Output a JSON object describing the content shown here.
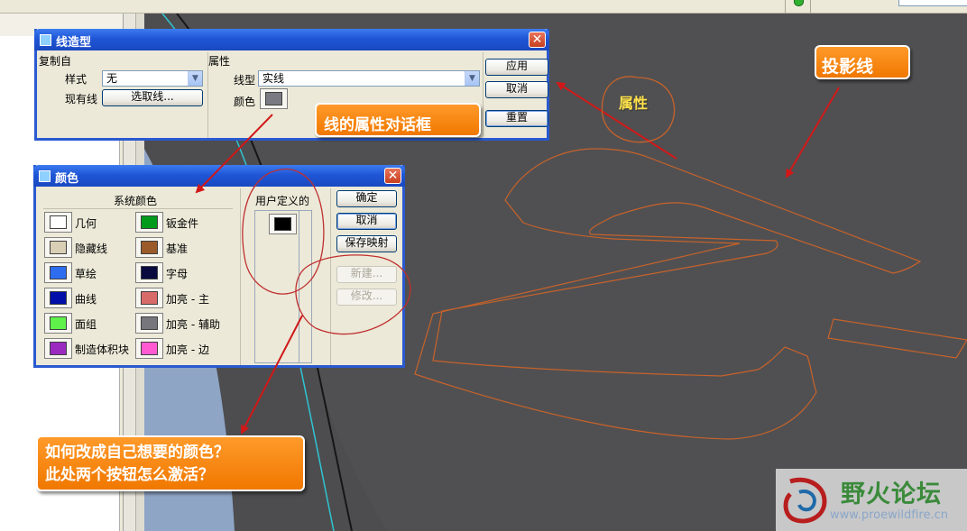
{
  "linestyle_dialog": {
    "title": "线造型",
    "copy_from_group": "复制自",
    "style_label": "样式",
    "style_value": "无",
    "existing_line_label": "现有线",
    "select_line_button": "选取线...",
    "properties_group": "属性",
    "linetype_label": "线型",
    "linetype_value": "实线",
    "color_label": "颜色",
    "color_value": "#7a7a82",
    "apply_button": "应用",
    "cancel_button": "取消",
    "reset_button": "重置"
  },
  "color_dialog": {
    "title": "颜色",
    "system_colors_header": "系统颜色",
    "user_defined_header": "用户定义的",
    "system_colors": [
      {
        "name": "几何",
        "color": "#ffffff"
      },
      {
        "name": "钣金件",
        "color": "#009a1c"
      },
      {
        "name": "隐藏线",
        "color": "#d9cfb4"
      },
      {
        "name": "基准",
        "color": "#9b5a2a"
      },
      {
        "name": "草绘",
        "color": "#2e6cf0"
      },
      {
        "name": "字母",
        "color": "#0a0a40"
      },
      {
        "name": "曲线",
        "color": "#0010a8"
      },
      {
        "name": "加亮 - 主",
        "color": "#d96a6a"
      },
      {
        "name": "面组",
        "color": "#5ef24a"
      },
      {
        "name": "加亮 - 辅助",
        "color": "#76767c"
      },
      {
        "name": "制造体积块",
        "color": "#9a2ac0"
      },
      {
        "name": "加亮 - 边",
        "color": "#ff5ad2"
      }
    ],
    "user_color": "#000000",
    "ok_button": "确定",
    "cancel_button": "取消",
    "save_map_button": "保存映射",
    "new_button": "新建...",
    "modify_button": "修改..."
  },
  "annotations": {
    "projection_line": "投影线",
    "properties": "属性",
    "line_props_dialog": "线的属性对话框",
    "question_line1": "如何改成自己想要的颜色？",
    "question_line2": "此处两个按钮怎么激活？"
  },
  "watermark": {
    "site_name": "野火论坛",
    "url": "www.proewildfire.cn"
  },
  "colors": {
    "callout_orange": "#f07800",
    "arrow_red": "#d01818",
    "curve_orange": "#c8622a",
    "viewport_bg": "#4d4d4f"
  }
}
